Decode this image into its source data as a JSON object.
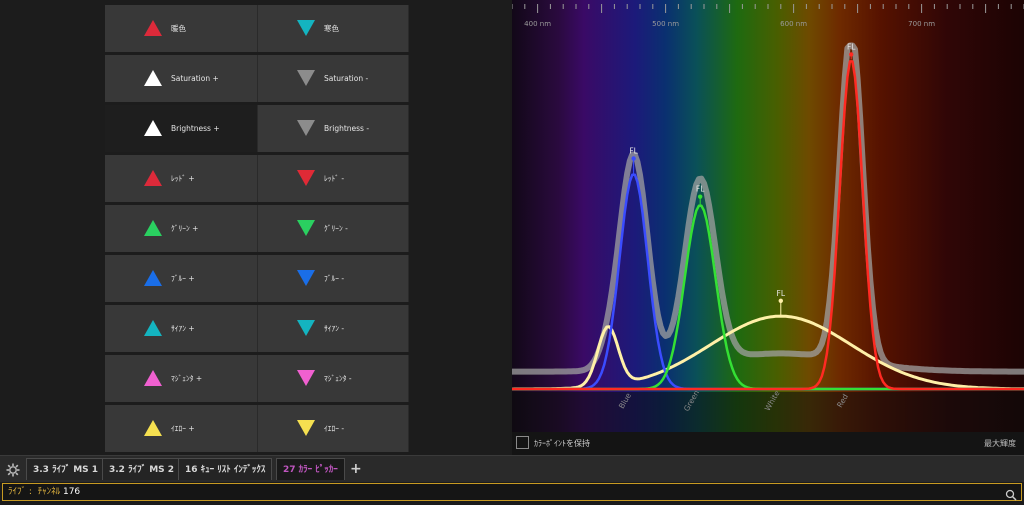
{
  "buttons": [
    {
      "label": "暖色",
      "dir": "up",
      "color": "#dc2a3a",
      "active": false
    },
    {
      "label": "寒色",
      "dir": "down",
      "color": "#14b4c0",
      "active": false
    },
    {
      "label": "Saturation +",
      "dir": "up",
      "color": "#ffffff",
      "active": false
    },
    {
      "label": "Saturation -",
      "dir": "down",
      "color": "#8c8c8c",
      "active": false
    },
    {
      "label": "Brightness +",
      "dir": "up",
      "color": "#ffffff",
      "active": true
    },
    {
      "label": "Brightness -",
      "dir": "down",
      "color": "#8c8c8c",
      "active": false
    },
    {
      "label": "ﾚｯﾄﾞ +",
      "dir": "up",
      "color": "#dc2a3a",
      "active": false
    },
    {
      "label": "ﾚｯﾄﾞ -",
      "dir": "down",
      "color": "#e02a36",
      "active": false
    },
    {
      "label": "ｸﾞﾘｰﾝ +",
      "dir": "up",
      "color": "#2ad060",
      "active": false
    },
    {
      "label": "ｸﾞﾘｰﾝ -",
      "dir": "down",
      "color": "#2ad060",
      "active": false
    },
    {
      "label": "ﾌﾞﾙｰ +",
      "dir": "up",
      "color": "#1a6ee8",
      "active": false
    },
    {
      "label": "ﾌﾞﾙｰ -",
      "dir": "down",
      "color": "#1a6ee8",
      "active": false
    },
    {
      "label": "ｻｲｱﾝ +",
      "dir": "up",
      "color": "#14b4c0",
      "active": false
    },
    {
      "label": "ｻｲｱﾝ -",
      "dir": "down",
      "color": "#14b4c0",
      "active": false
    },
    {
      "label": "ﾏｼﾞｪﾝﾀ +",
      "dir": "up",
      "color": "#f060d0",
      "active": false
    },
    {
      "label": "ﾏｼﾞｪﾝﾀ -",
      "dir": "down",
      "color": "#f060d0",
      "active": false
    },
    {
      "label": "ｲｴﾛｰ +",
      "dir": "up",
      "color": "#f5e050",
      "active": false
    },
    {
      "label": "ｲｴﾛｰ -",
      "dir": "down",
      "color": "#f5e050",
      "active": false
    }
  ],
  "spectrum": {
    "axis_labels": [
      "400 nm",
      "500 nm",
      "600 nm",
      "700 nm"
    ],
    "axis_nm": [
      400,
      500,
      600,
      700
    ],
    "axis_range_nm": [
      380,
      780
    ],
    "fl_label": "FL",
    "peaks": [
      {
        "name": "Blue",
        "color": "#3a4cff",
        "peak_nm": 475,
        "level": 0.62
      },
      {
        "name": "Green",
        "color": "#34e034",
        "peak_nm": 527,
        "level": 0.53
      },
      {
        "name": "Red",
        "color": "#ff2a22",
        "peak_nm": 645,
        "level": 0.95
      },
      {
        "name": "White",
        "color": "#fff0a8",
        "peak_nm": 590,
        "level": 0.21
      }
    ],
    "markers": [
      {
        "label": "FL",
        "nm": 475,
        "level": 0.67
      },
      {
        "label": "FL",
        "nm": 527,
        "level": 0.56
      },
      {
        "label": "FL",
        "nm": 590,
        "level": 0.26
      },
      {
        "label": "FL",
        "nm": 645,
        "level": 0.97
      }
    ]
  },
  "bottom_bar": {
    "keep_label": "ｶﾗｰﾎﾟｲﾝﾄを保持",
    "max_label": "最大輝度"
  },
  "tabs": [
    {
      "label": "3.3 ﾗｲﾌﾞ MS 1",
      "active": false
    },
    {
      "label": "3.2 ﾗｲﾌﾞ MS 2",
      "active": false
    },
    {
      "label": "16 ｷｭｰ ﾘｽﾄ ｲﾝﾃﾞｯｸｽ",
      "active": false
    },
    {
      "label": "27 ｶﾗｰ ﾋﾟｯｶｰ",
      "active": true
    }
  ],
  "add_tab_label": "+",
  "command_line": {
    "prompt": "ﾗｲﾌﾞ :  ﾁｬﾝﾈﾙ ",
    "value": "176"
  },
  "colors": {
    "accent": "#c79a22",
    "active_tab": "#c056c0"
  }
}
